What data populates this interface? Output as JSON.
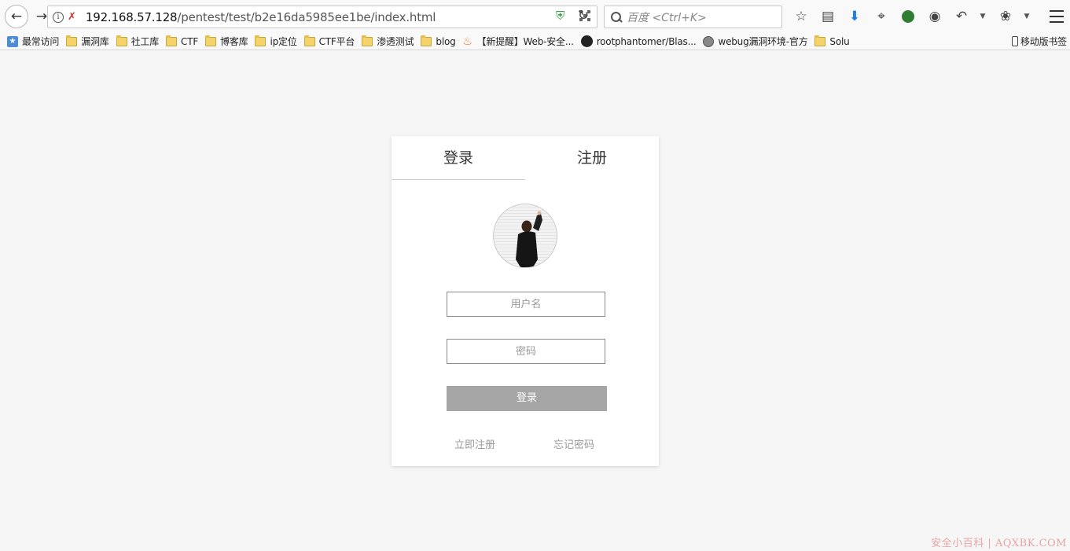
{
  "browser": {
    "url_host": "192.168.57.128",
    "url_path": "/pentest/test/b2e16da5985ee1be/index.html",
    "search_placeholder": "百度 <Ctrl+K>",
    "bookmarks": [
      {
        "label": "最常访问",
        "icon": "most-visited-icon"
      },
      {
        "label": "漏洞库",
        "icon": "folder-icon"
      },
      {
        "label": "社工库",
        "icon": "folder-icon"
      },
      {
        "label": "CTF",
        "icon": "folder-icon"
      },
      {
        "label": "博客库",
        "icon": "folder-icon"
      },
      {
        "label": "ip定位",
        "icon": "folder-icon"
      },
      {
        "label": "CTF平台",
        "icon": "folder-icon"
      },
      {
        "label": "渗透测试",
        "icon": "folder-icon"
      },
      {
        "label": "blog",
        "icon": "folder-icon"
      },
      {
        "label": "【新提醒】Web-安全...",
        "icon": "site-icon"
      },
      {
        "label": "rootphantomer/Blas...",
        "icon": "github-icon"
      },
      {
        "label": "webug漏洞环境-官方",
        "icon": "globe-icon"
      },
      {
        "label": "Solu",
        "icon": "folder-icon"
      }
    ],
    "mobile_bookmarks": "移动版书签"
  },
  "login_card": {
    "tab_login": "登录",
    "tab_register": "注册",
    "username_placeholder": "用户名",
    "password_placeholder": "密码",
    "login_button": "登录",
    "register_link": "立即注册",
    "forgot_link": "忘记密码"
  },
  "watermark": "安全小百科 | AQXBK.COM"
}
